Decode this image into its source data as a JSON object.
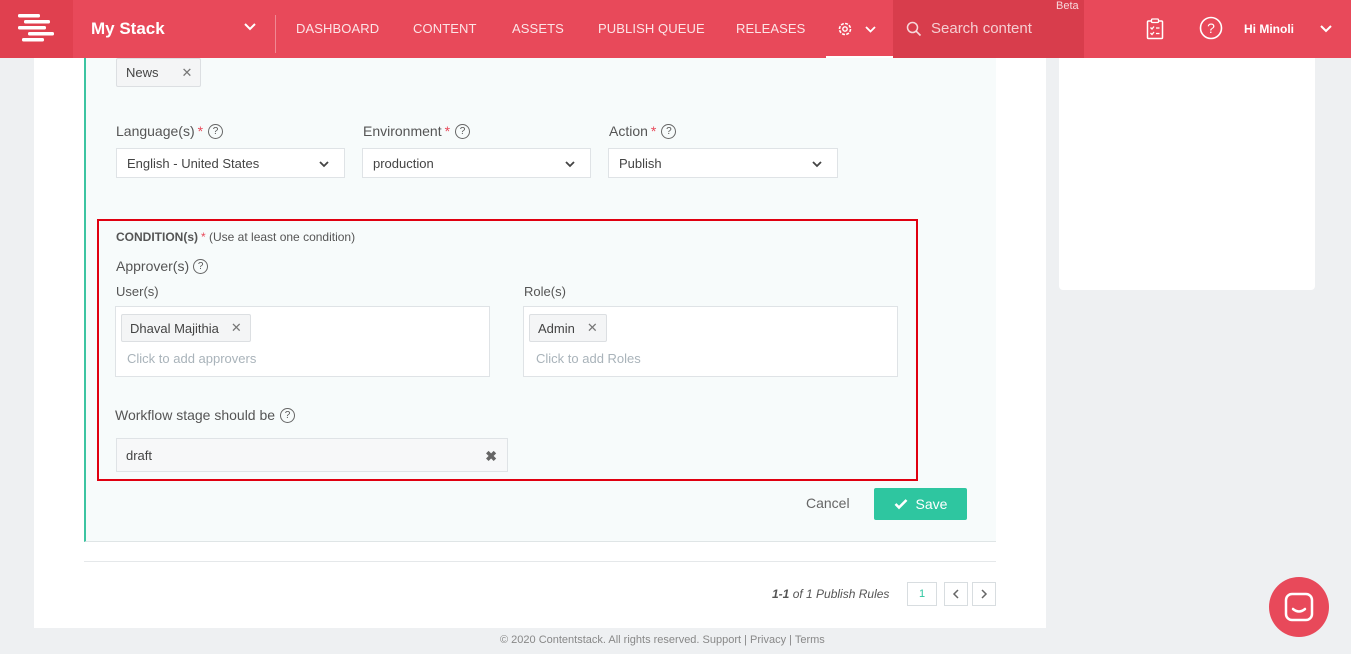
{
  "header": {
    "stack_name": "My Stack",
    "nav": [
      "DASHBOARD",
      "CONTENT",
      "ASSETS",
      "PUBLISH QUEUE",
      "RELEASES"
    ],
    "search_placeholder": "Search content",
    "beta": "Beta",
    "greeting": "Hi Minoli"
  },
  "form": {
    "content_tag": "News",
    "language": {
      "label": "Language(s)",
      "value": "English - United States"
    },
    "environment": {
      "label": "Environment",
      "value": "production"
    },
    "action": {
      "label": "Action",
      "value": "Publish"
    },
    "required_mark": "*",
    "help_mark": "?"
  },
  "conditions": {
    "title": "CONDITION(s)",
    "hint": "(Use at least one condition)",
    "approvers_label": "Approver(s)",
    "users_label": "User(s)",
    "roles_label": "Role(s)",
    "user_tag": "Dhaval Majithia",
    "role_tag": "Admin",
    "users_placeholder": "Click to add approvers",
    "roles_placeholder": "Click to add Roles",
    "stage_label": "Workflow stage should be",
    "stage_value": "draft"
  },
  "actions": {
    "cancel": "Cancel",
    "save": "Save"
  },
  "pagination": {
    "range": "1-1",
    "text": "of 1 Publish Rules",
    "current_page": "1"
  },
  "footer": "© 2020 Contentstack. All rights reserved. Support | Privacy | Terms",
  "colors": {
    "brand": "#e8495a",
    "accent": "#2ec6a0",
    "highlight": "#e00010"
  }
}
